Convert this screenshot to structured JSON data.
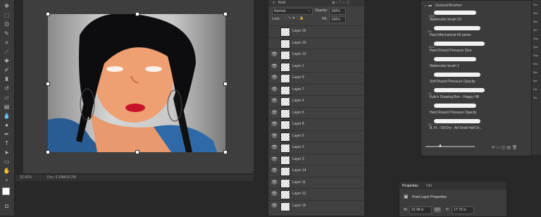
{
  "colors": {
    "foreground": "#ffffff",
    "background": "#1f1f1f",
    "panel": "#404040"
  },
  "status": {
    "zoom": "22.42%",
    "doc": "Doc: 6.10M/33.2M"
  },
  "layers": {
    "blend_mode": "Normal",
    "opacity_label": "Opacity:",
    "opacity_value": "100%",
    "lock_label": "Lock:",
    "fill_label": "Fill:",
    "fill_value": "100%",
    "kind_label": "Kind",
    "items": [
      {
        "name": "Layer 16",
        "visible": false
      },
      {
        "name": "Layer 10",
        "visible": false
      },
      {
        "name": "Layer 13",
        "visible": true
      },
      {
        "name": "Layer 1",
        "visible": true
      },
      {
        "name": "Layer 9",
        "visible": true
      },
      {
        "name": "Layer 7",
        "visible": true
      },
      {
        "name": "Layer 4",
        "visible": true
      },
      {
        "name": "Layer 6",
        "visible": true
      },
      {
        "name": "Layer 8",
        "visible": true
      },
      {
        "name": "Layer 5",
        "visible": true
      },
      {
        "name": "Layer 2",
        "visible": true
      },
      {
        "name": "Layer 3",
        "visible": true
      },
      {
        "name": "Layer 14",
        "visible": true
      },
      {
        "name": "Layer 11",
        "visible": true
      },
      {
        "name": "Layer 12",
        "visible": true
      },
      {
        "name": "Layer 15",
        "visible": true
      }
    ]
  },
  "brushes": {
    "group": "General Brushes",
    "items": [
      {
        "size": "1000",
        "name": "Watercolor brush 10"
      },
      {
        "size": "60",
        "name": "Hard Mechanical 60 pixels"
      },
      {
        "size": "1674",
        "name": "Hard Round Pressure Size"
      },
      {
        "size": "",
        "name": "Watercolor brush 1"
      },
      {
        "size": "",
        "name": "Soft Round Pressure Opacity"
      },
      {
        "size": "10",
        "name": "Kyle's Drawing Box - Happy HB"
      },
      {
        "size": "",
        "name": "Hard Round Pressure Opacity"
      },
      {
        "size": "60",
        "name": "B. H. - Oil Dry - Art Draft Half Dr..."
      }
    ]
  },
  "properties": {
    "tab1": "Properties",
    "tab2": "Info",
    "section": "Pixel Layer Properties",
    "w_label": "W:",
    "w_value": "22.98 in",
    "go_label": "GO",
    "h_label": "H:",
    "h_value": "17.75 in"
  },
  "right_strip": [
    "Fla",
    "Wa",
    "Bla",
    "Mo",
    "Say",
    "Qui",
    "Say",
    "Wa",
    "Bla",
    "Ide",
    "Ha",
    "Sa"
  ]
}
